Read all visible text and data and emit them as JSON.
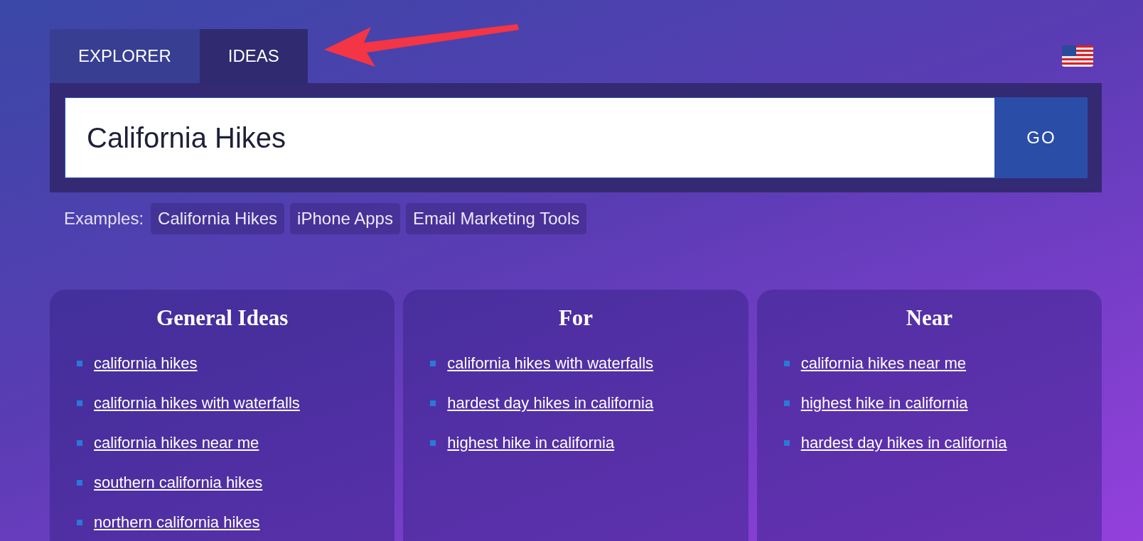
{
  "tabs": [
    {
      "label": "EXPLORER",
      "selected": false
    },
    {
      "label": "IDEAS",
      "selected": true
    }
  ],
  "search": {
    "value": "California Hikes",
    "button": "GO"
  },
  "examples": {
    "label": "Examples:",
    "items": [
      "California Hikes",
      "iPhone Apps",
      "Email Marketing Tools"
    ]
  },
  "columns": [
    {
      "title": "General Ideas",
      "items": [
        "california hikes",
        "california hikes with waterfalls",
        "california hikes near me",
        "southern california hikes",
        "northern california hikes"
      ]
    },
    {
      "title": "For",
      "items": [
        "california hikes with waterfalls",
        "hardest day hikes in california",
        "highest hike in california"
      ]
    },
    {
      "title": "Near",
      "items": [
        "california hikes near me",
        "highest hike in california",
        "hardest day hikes in california"
      ]
    }
  ]
}
